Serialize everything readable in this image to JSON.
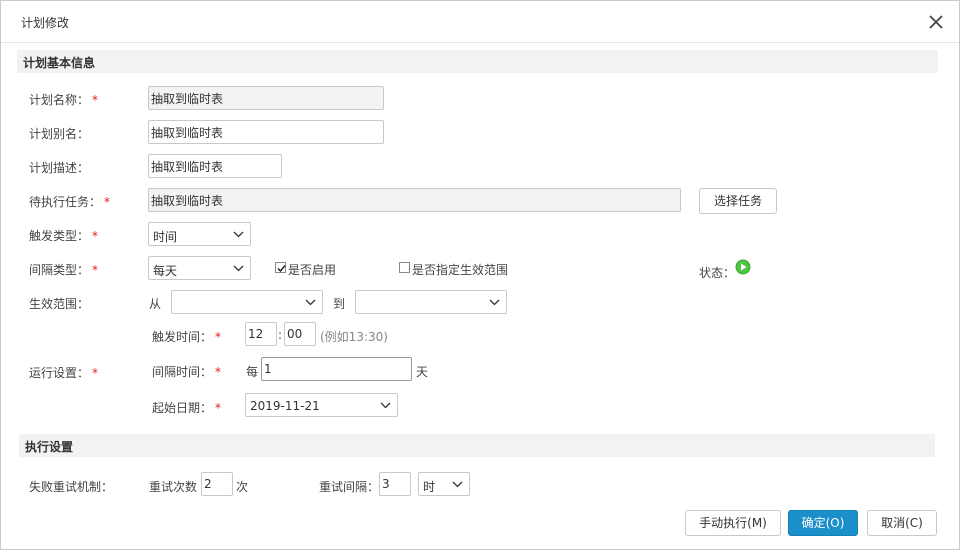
{
  "dialog": {
    "title": "计划修改"
  },
  "sections": {
    "basic": "计划基本信息",
    "exec": "执行设置"
  },
  "fields": {
    "name_label": "计划名称：",
    "name_value": "抽取到临时表",
    "alias_label": "计划别名：",
    "alias_value": "抽取到临时表",
    "desc_label": "计划描述：",
    "desc_value": "抽取到临时表",
    "task_label": "待执行任务：",
    "task_value": "抽取到临时表",
    "choose_task_button": "选择任务",
    "trigger_type_label": "触发类型：",
    "trigger_type_value": "时间",
    "interval_type_label": "间隔类型：",
    "interval_type_value": "每天",
    "enable_label": "是否启用",
    "enable_checked": true,
    "range_specify_label": "是否指定生效范围",
    "range_specify_checked": false,
    "status_label": "状态：",
    "range_label": "生效范围：",
    "range_from": "从",
    "range_from_value": "",
    "range_to": "到",
    "range_to_value": "",
    "run_label": "运行设置：",
    "trigger_time_label": "触发时间：",
    "hour": "12",
    "colon": ":",
    "minute": "00",
    "time_hint": "(例如13:30)",
    "interval_time_label": "间隔时间：",
    "every": "每",
    "interval_value": "1",
    "day_unit": "天",
    "start_date_label": "起始日期：",
    "start_date_value": "2019-11-21",
    "required_mark": "*"
  },
  "exec": {
    "retry_label": "失败重试机制：",
    "retry_count_label": "重试次数",
    "retry_count_value": "2",
    "retry_count_unit": "次",
    "retry_interval_label": "重试间隔：",
    "retry_interval_value": "3",
    "retry_interval_unit": "时"
  },
  "footer": {
    "manual_run": "手动执行(M)",
    "confirm": "确定(O)",
    "cancel": "取消(C)"
  },
  "colors": {
    "primary": "#1a8fc9",
    "required": "#e02020",
    "status_green": "#3cb034"
  }
}
